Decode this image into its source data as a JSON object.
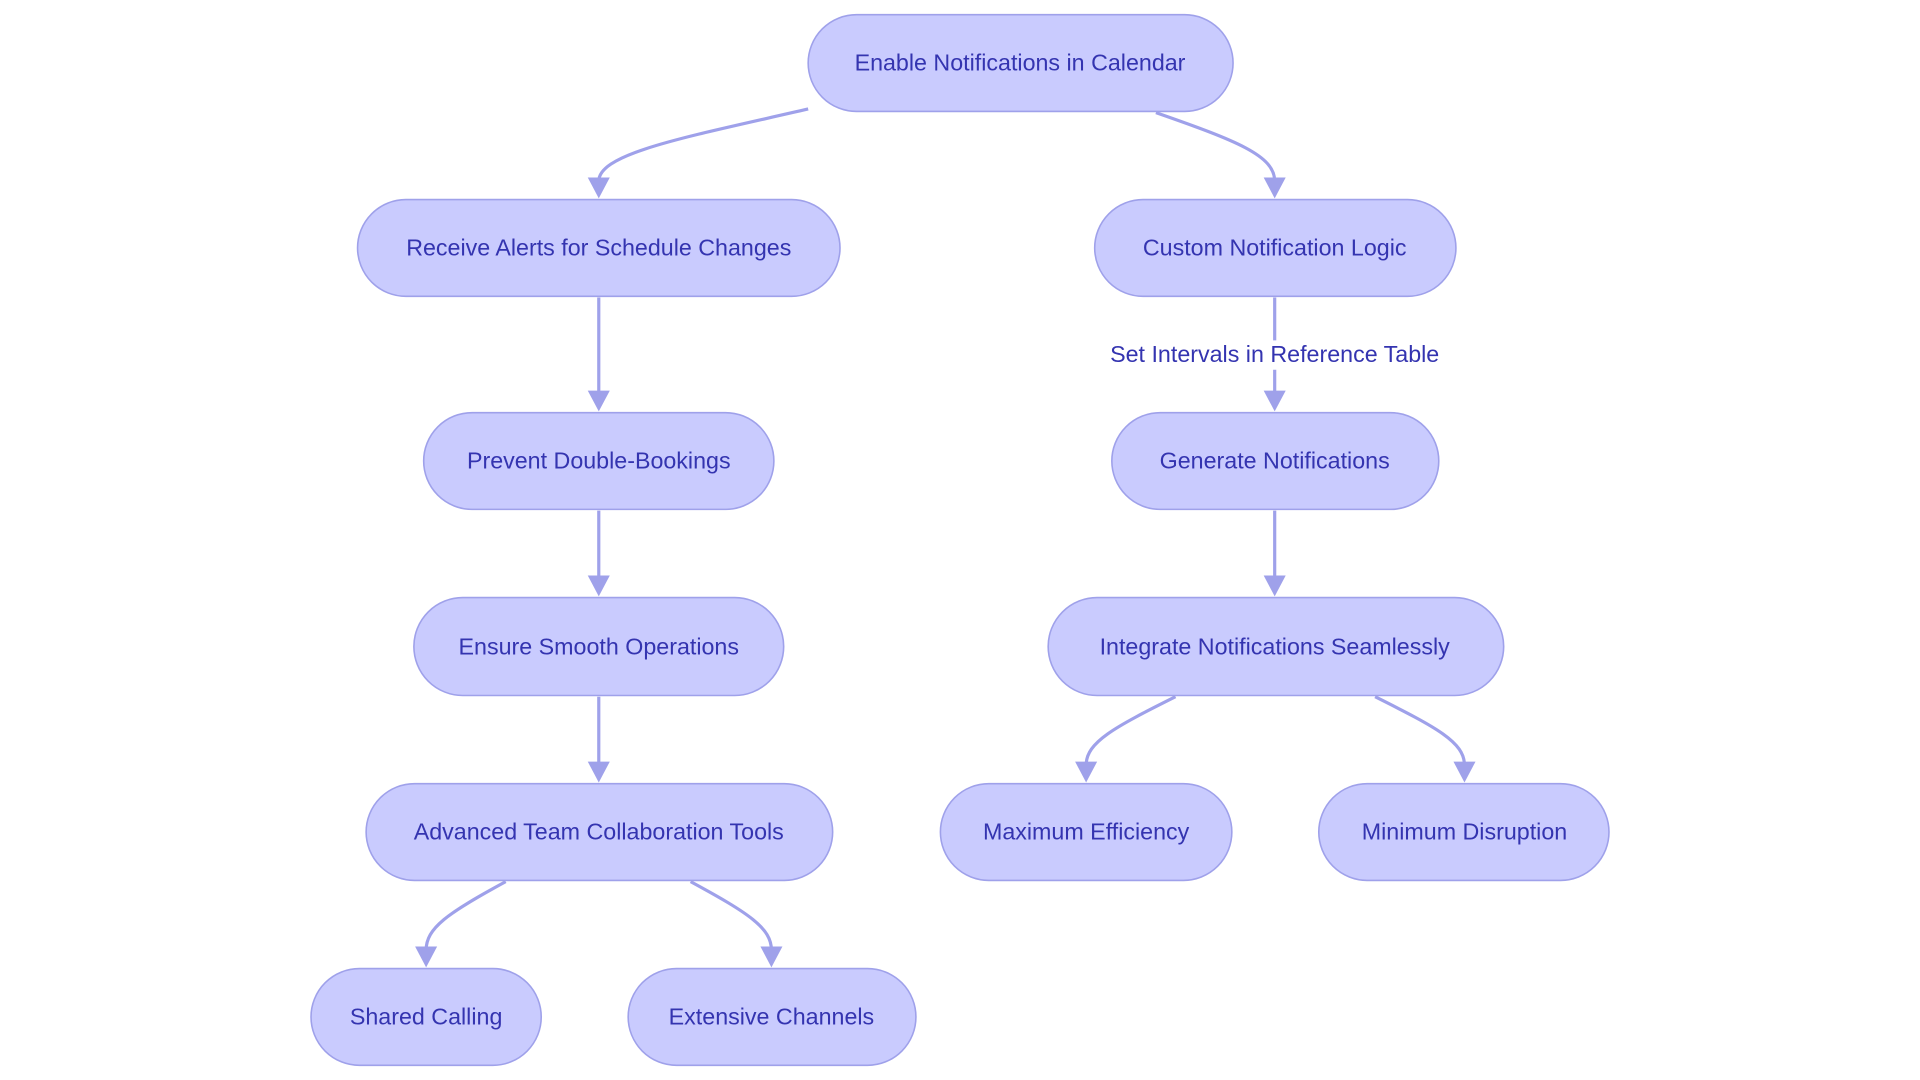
{
  "diagram": {
    "type": "flowchart",
    "colors": {
      "node_fill": "#c9cbfe",
      "node_border": "#9fa1ea",
      "text": "#3434b0",
      "edge": "#9fa1ea"
    },
    "nodes": {
      "enable": "Enable Notifications in Calendar",
      "receive": "Receive Alerts for Schedule Changes",
      "custom": "Custom Notification Logic",
      "prevent": "Prevent Double-Bookings",
      "generate": "Generate Notifications",
      "ensure": "Ensure Smooth Operations",
      "integrate": "Integrate Notifications Seamlessly",
      "advanced": "Advanced Team Collaboration Tools",
      "maxeff": "Maximum Efficiency",
      "mindis": "Minimum Disruption",
      "shared": "Shared Calling",
      "extensive": "Extensive Channels"
    },
    "edges": [
      {
        "from": "enable",
        "to": "receive"
      },
      {
        "from": "enable",
        "to": "custom"
      },
      {
        "from": "receive",
        "to": "prevent"
      },
      {
        "from": "custom",
        "to": "generate",
        "label": "Set Intervals in Reference Table"
      },
      {
        "from": "prevent",
        "to": "ensure"
      },
      {
        "from": "generate",
        "to": "integrate"
      },
      {
        "from": "ensure",
        "to": "advanced"
      },
      {
        "from": "integrate",
        "to": "maxeff"
      },
      {
        "from": "integrate",
        "to": "mindis"
      },
      {
        "from": "advanced",
        "to": "shared"
      },
      {
        "from": "advanced",
        "to": "extensive"
      }
    ]
  }
}
